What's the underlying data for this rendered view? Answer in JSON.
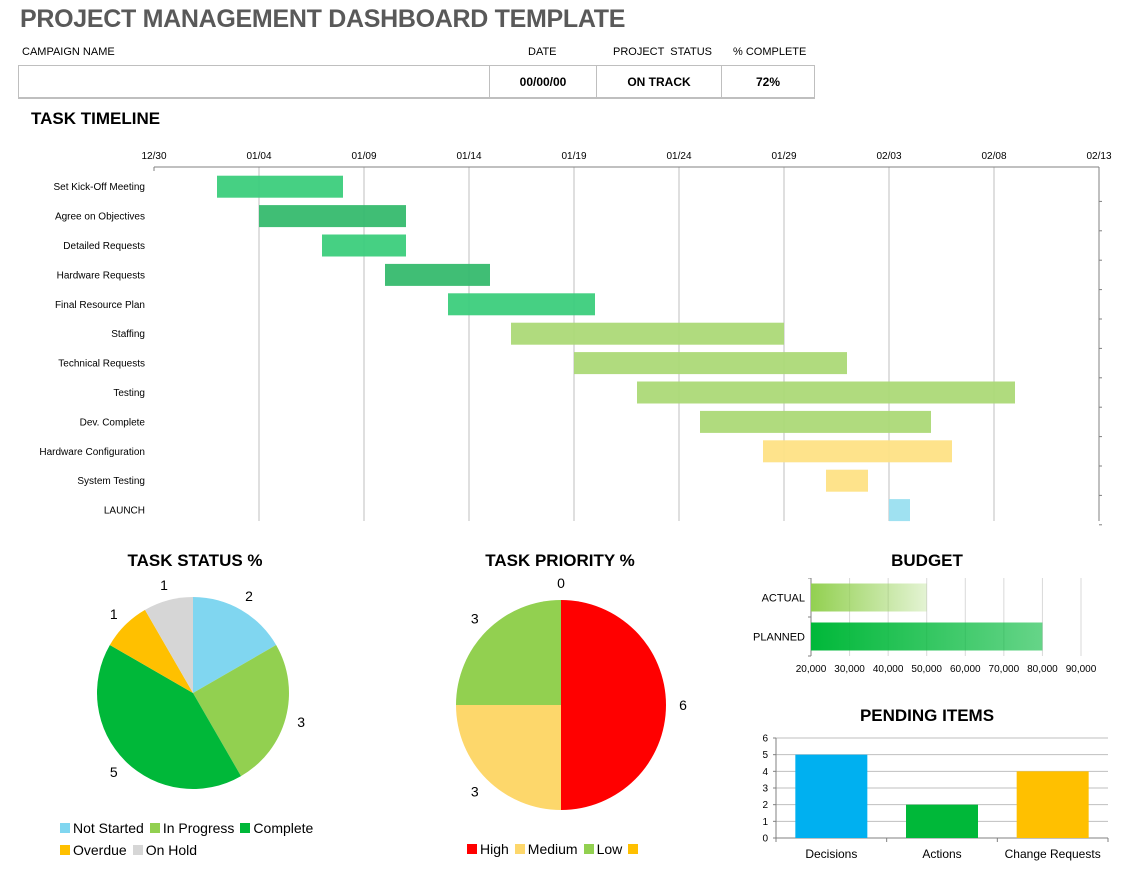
{
  "page": {
    "title": "PROJECT MANAGEMENT DASHBOARD TEMPLATE"
  },
  "header": {
    "campaign_label": "CAMPAIGN NAME",
    "campaign_value": "",
    "date_label": "DATE",
    "date_value": "00/00/00",
    "status_label": "PROJECT  STATUS",
    "status_value": "ON TRACK",
    "complete_label": "% COMPLETE",
    "complete_value": "72%"
  },
  "timeline": {
    "title": "TASK TIMELINE"
  },
  "chart_data": [
    {
      "type": "gantt",
      "title": "TASK TIMELINE",
      "x_ticks": [
        "12/30",
        "01/04",
        "01/09",
        "01/14",
        "01/19",
        "01/24",
        "01/29",
        "02/03",
        "02/08",
        "02/13"
      ],
      "x_range_days": [
        0,
        45
      ],
      "x_origin": "12/30",
      "grid": true,
      "tasks": [
        {
          "name": "Set Kick-Off Meeting",
          "start": "01/02",
          "end": "01/08",
          "start_day": 3,
          "duration": 6,
          "color": "#3ccd7c"
        },
        {
          "name": "Agree on Objectives",
          "start": "01/04",
          "end": "01/11",
          "start_day": 5,
          "duration": 7,
          "color": "#36bb6e"
        },
        {
          "name": "Detailed Requests",
          "start": "01/07",
          "end": "01/11",
          "start_day": 8,
          "duration": 4,
          "color": "#3ccd7c"
        },
        {
          "name": "Hardware Requests",
          "start": "01/10",
          "end": "01/15",
          "start_day": 11,
          "duration": 5,
          "color": "#36bb6e"
        },
        {
          "name": "Final Resource Plan",
          "start": "01/13",
          "end": "01/20",
          "start_day": 14,
          "duration": 7,
          "color": "#3ccd7c"
        },
        {
          "name": "Staffing",
          "start": "01/16",
          "end": "01/29",
          "start_day": 17,
          "duration": 13,
          "color": "#acd977"
        },
        {
          "name": "Technical Requests",
          "start": "01/19",
          "end": "02/01",
          "start_day": 20,
          "duration": 13,
          "color": "#acd977"
        },
        {
          "name": "Testing",
          "start": "01/22",
          "end": "02/09",
          "start_day": 23,
          "duration": 18,
          "color": "#acd977"
        },
        {
          "name": "Dev. Complete",
          "start": "01/25",
          "end": "02/05",
          "start_day": 26,
          "duration": 11,
          "color": "#acd977"
        },
        {
          "name": "Hardware Configuration",
          "start": "01/28",
          "end": "02/06",
          "start_day": 29,
          "duration": 9,
          "color": "#fee185"
        },
        {
          "name": "System Testing",
          "start": "01/31",
          "end": "02/02",
          "start_day": 32,
          "duration": 2,
          "color": "#fee185"
        },
        {
          "name": "LAUNCH",
          "start": "02/03",
          "end": "02/04",
          "start_day": 35,
          "duration": 1,
          "color": "#9adff0"
        }
      ]
    },
    {
      "type": "pie",
      "title": "TASK STATUS %",
      "legend": "bottom",
      "slices": [
        {
          "label": "Not Started",
          "value": 2,
          "color": "#80d6f0"
        },
        {
          "label": "In Progress",
          "value": 3,
          "color": "#92d050"
        },
        {
          "label": "Complete",
          "value": 5,
          "color": "#00b839"
        },
        {
          "label": "Overdue",
          "value": 1,
          "color": "#ffc000"
        },
        {
          "label": "On Hold",
          "value": 1,
          "color": "#d6d6d6"
        }
      ]
    },
    {
      "type": "pie",
      "title": "TASK PRIORITY %",
      "legend": "bottom",
      "slices": [
        {
          "label": "High",
          "value": 6,
          "color": "#ff0000"
        },
        {
          "label": "Medium",
          "value": 3,
          "color": "#fdd76b"
        },
        {
          "label": "Low",
          "value": 3,
          "color": "#92d050"
        },
        {
          "label": "",
          "value": 0,
          "color": "#ffc000"
        }
      ]
    },
    {
      "type": "bar",
      "orientation": "horizontal",
      "title": "BUDGET",
      "categories": [
        "ACTUAL",
        "PLANNED"
      ],
      "values": [
        50000,
        80000
      ],
      "xlim": [
        20000,
        90000
      ],
      "x_ticks": [
        "20,000",
        "30,000",
        "40,000",
        "50,000",
        "60,000",
        "70,000",
        "80,000",
        "90,000"
      ],
      "colors": [
        "#92d050",
        "#00b839"
      ],
      "grid": true
    },
    {
      "type": "bar",
      "title": "PENDING ITEMS",
      "categories": [
        "Decisions",
        "Actions",
        "Change Requests"
      ],
      "values": [
        5,
        2,
        4
      ],
      "ylim": [
        0,
        6
      ],
      "y_ticks": [
        "0",
        "1",
        "2",
        "3",
        "4",
        "5",
        "6"
      ],
      "colors": [
        "#00b0f0",
        "#00b839",
        "#ffc000"
      ],
      "grid": true
    }
  ]
}
